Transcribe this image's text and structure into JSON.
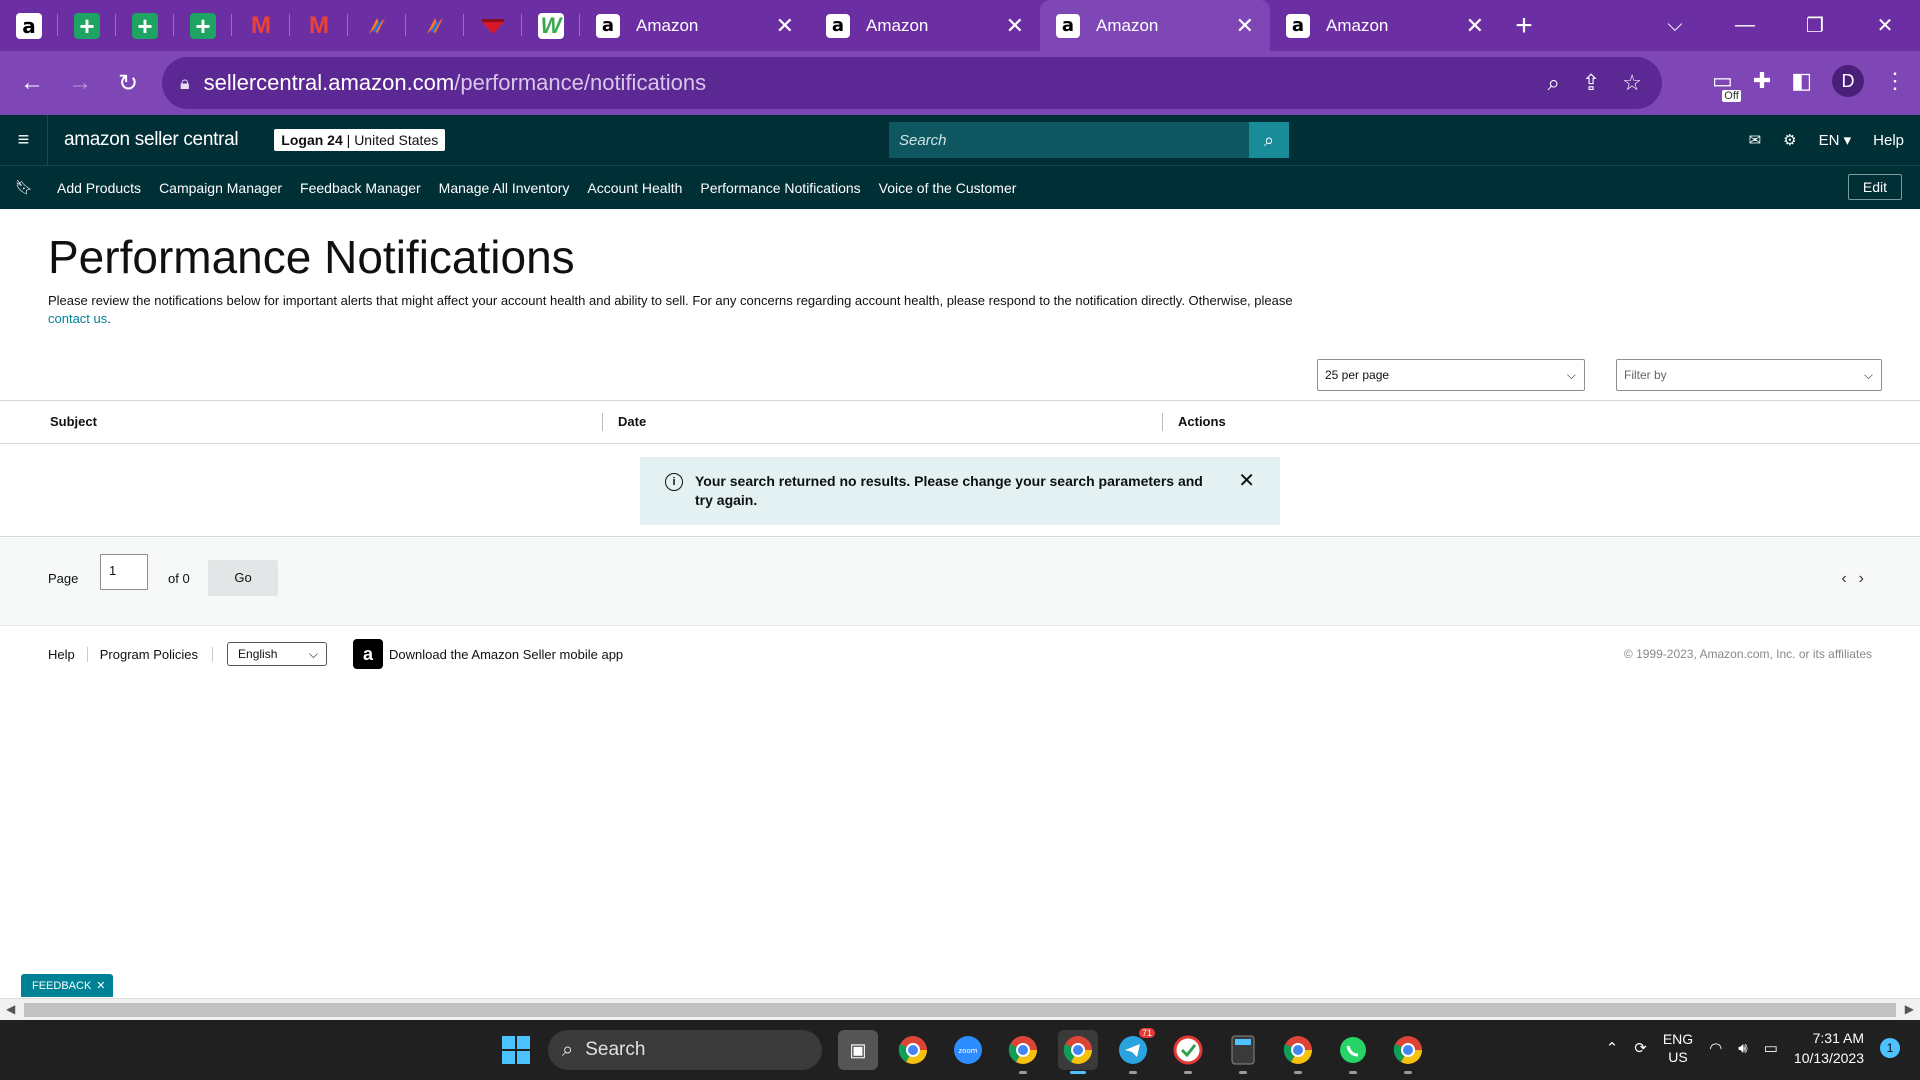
{
  "browser": {
    "tabs": [
      {
        "label": "Amazon",
        "active": false
      },
      {
        "label": "Amazon",
        "active": false
      },
      {
        "label": "Amazon",
        "active": true
      },
      {
        "label": "Amazon",
        "active": false
      }
    ],
    "url_domain": "sellercentral.amazon.com",
    "url_path": "/performance/notifications",
    "profile_initial": "D",
    "extension_badge": "Off",
    "theme_color": "#7f46b5"
  },
  "header": {
    "brand": "amazon seller central",
    "account_name": "Logan 24",
    "account_region": "United States",
    "search_placeholder": "Search",
    "language": "EN",
    "help": "Help"
  },
  "bookmarks": {
    "items": [
      "Add Products",
      "Campaign Manager",
      "Feedback Manager",
      "Manage All Inventory",
      "Account Health",
      "Performance Notifications",
      "Voice of the Customer"
    ],
    "edit_label": "Edit"
  },
  "main": {
    "title": "Performance Notifications",
    "description": "Please review the notifications below for important alerts that might affect your account health and ability to sell. For any concerns regarding account health, please respond to the notification directly. Otherwise, please",
    "contact_link": "contact us",
    "per_page": "25 per page",
    "filter_placeholder": "Filter by",
    "columns": [
      "Subject",
      "Date",
      "Actions"
    ],
    "alert_text": "Your search returned no results. Please change your search parameters and try again."
  },
  "pager": {
    "page_label": "Page",
    "page_value": "1",
    "of_label": "of 0",
    "go_label": "Go"
  },
  "footer": {
    "help": "Help",
    "policies": "Program Policies",
    "language": "English",
    "download_app": "Download the Amazon Seller mobile app",
    "copyright": "© 1999-2023, Amazon.com, Inc. or its affiliates"
  },
  "feedback": {
    "label": "FEEDBACK"
  },
  "taskbar": {
    "search_label": "Search",
    "telegram_badge": "71",
    "lang_line1": "ENG",
    "lang_line2": "US",
    "time": "7:31 AM",
    "date": "10/13/2023",
    "notification_count": "1"
  }
}
